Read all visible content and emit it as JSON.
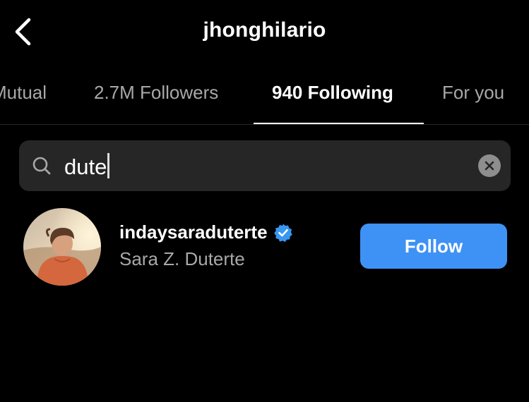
{
  "header": {
    "title": "jhonghilario",
    "back_icon": "chevron-left-icon"
  },
  "tabs": [
    {
      "label": "Mutual",
      "active": false
    },
    {
      "label": "2.7M Followers",
      "active": false
    },
    {
      "label": "940 Following",
      "active": true
    },
    {
      "label": "For you",
      "active": false
    }
  ],
  "search": {
    "value": "dute",
    "icon": "search-icon",
    "clear_icon": "clear-icon"
  },
  "results": [
    {
      "username": "indaysaraduterte",
      "verified": true,
      "full_name": "Sara Z. Duterte",
      "button_label": "Follow"
    }
  ],
  "colors": {
    "background": "#000000",
    "search_bg": "#262626",
    "secondary_text": "#a8a8a8",
    "follow_button": "#3f92f5",
    "verified_badge": "#3897f0"
  }
}
